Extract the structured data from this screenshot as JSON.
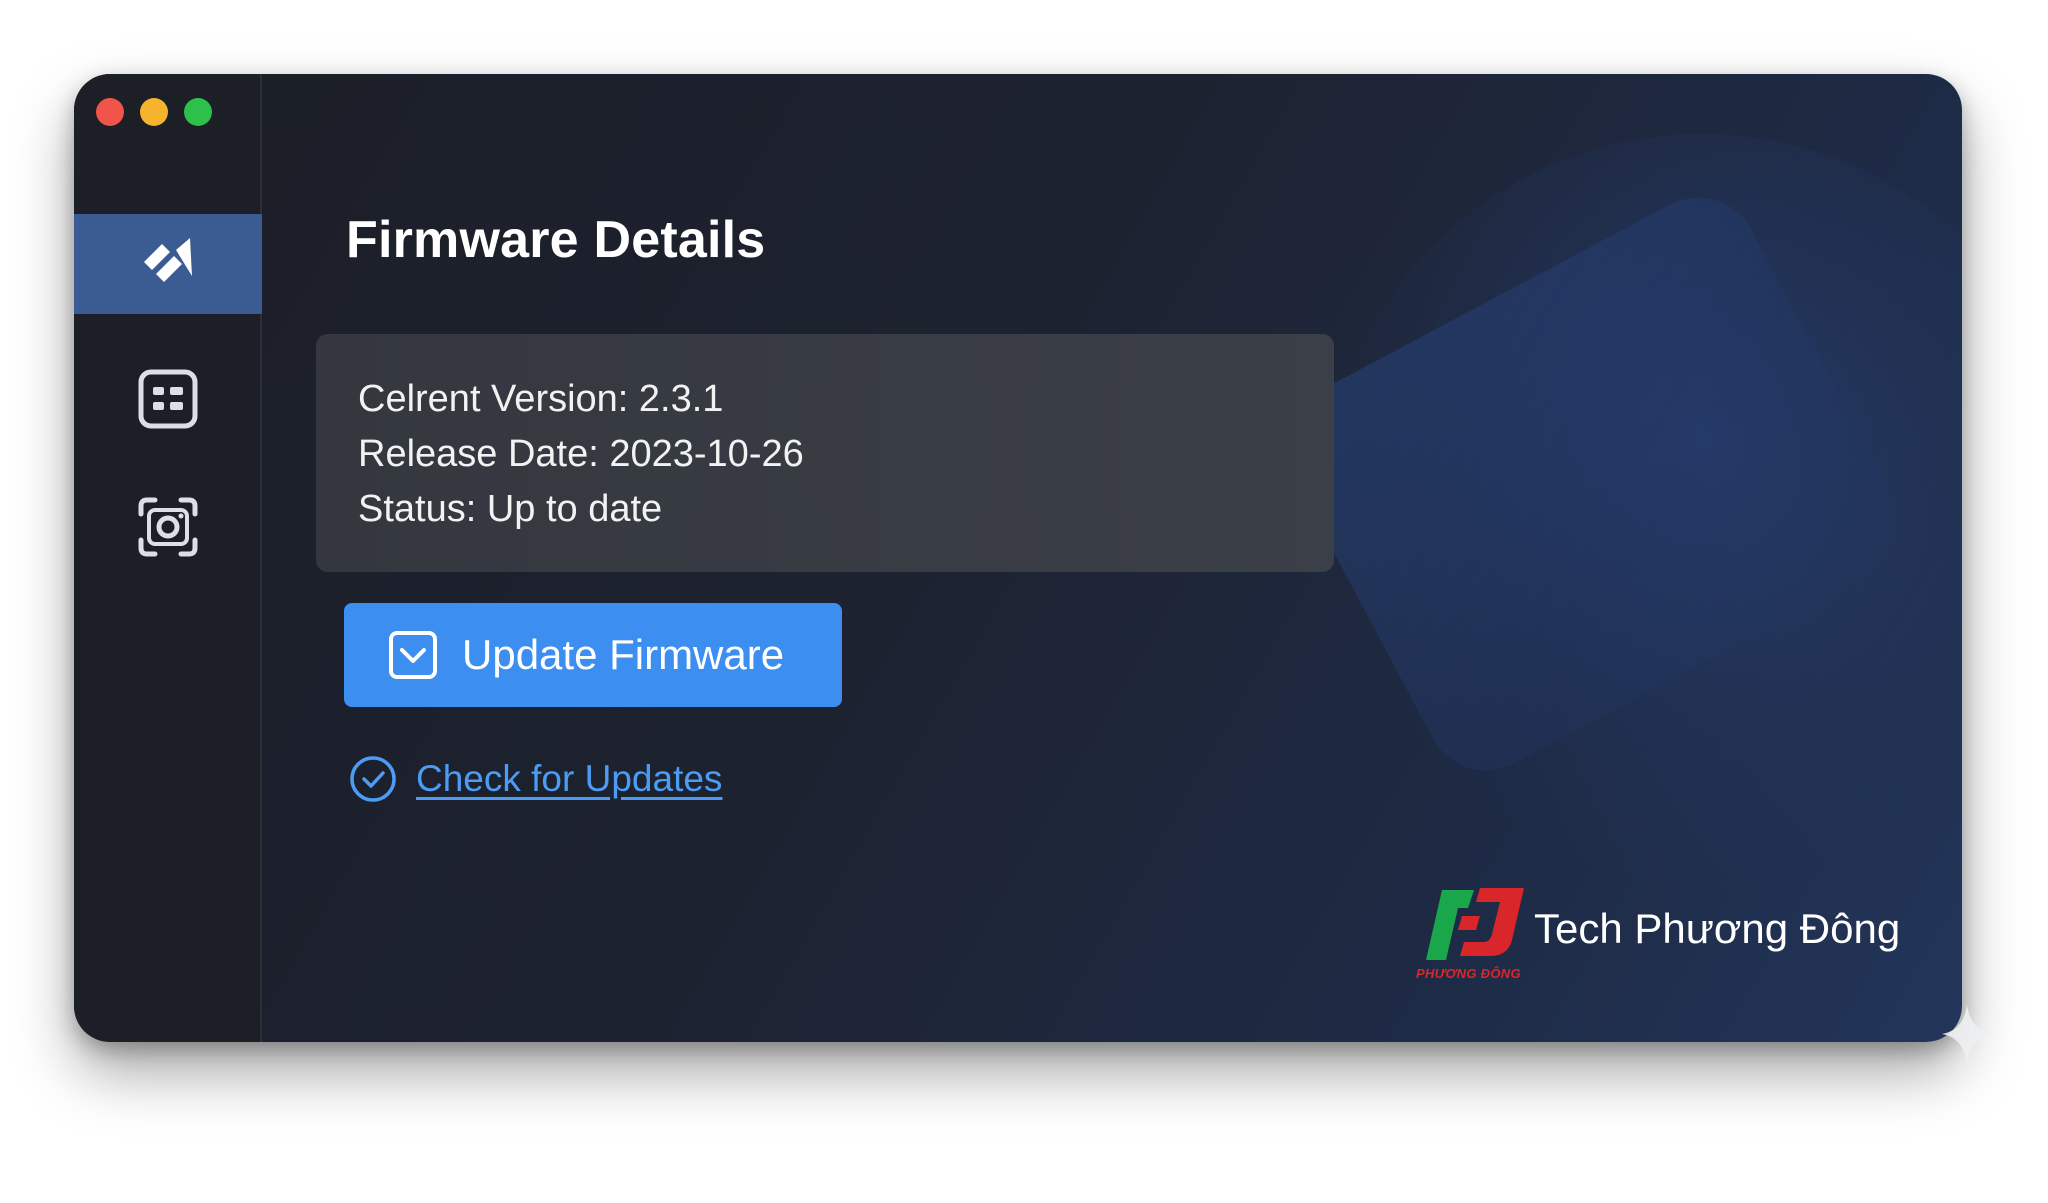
{
  "window": {
    "controls": [
      "close",
      "minimize",
      "maximize"
    ]
  },
  "sidebar": {
    "items": [
      {
        "icon": "firmware-icon",
        "active": true
      },
      {
        "icon": "grid-icon",
        "active": false
      },
      {
        "icon": "camera-icon",
        "active": false
      }
    ]
  },
  "main": {
    "title": "Firmware Details",
    "info": {
      "version_line": "Celrent Version: 2.3.1",
      "release_line": "Release Date: 2023-10-26",
      "status_line": "Status: Up to date"
    },
    "update_button": {
      "label": "Update Firmware",
      "icon": "download-box-icon"
    },
    "check_link": {
      "label": "Check for Updates",
      "icon": "check-circle-icon"
    }
  },
  "brand": {
    "name": "Tech Phương Đông",
    "logo_caption": "PHƯƠNG ĐÔNG",
    "colors": {
      "green": "#1aa64b",
      "red": "#d8262a"
    }
  },
  "colors": {
    "accent": "#3c8ef0",
    "link": "#4c9cf5",
    "sidebar_active": "#3b5b93"
  }
}
